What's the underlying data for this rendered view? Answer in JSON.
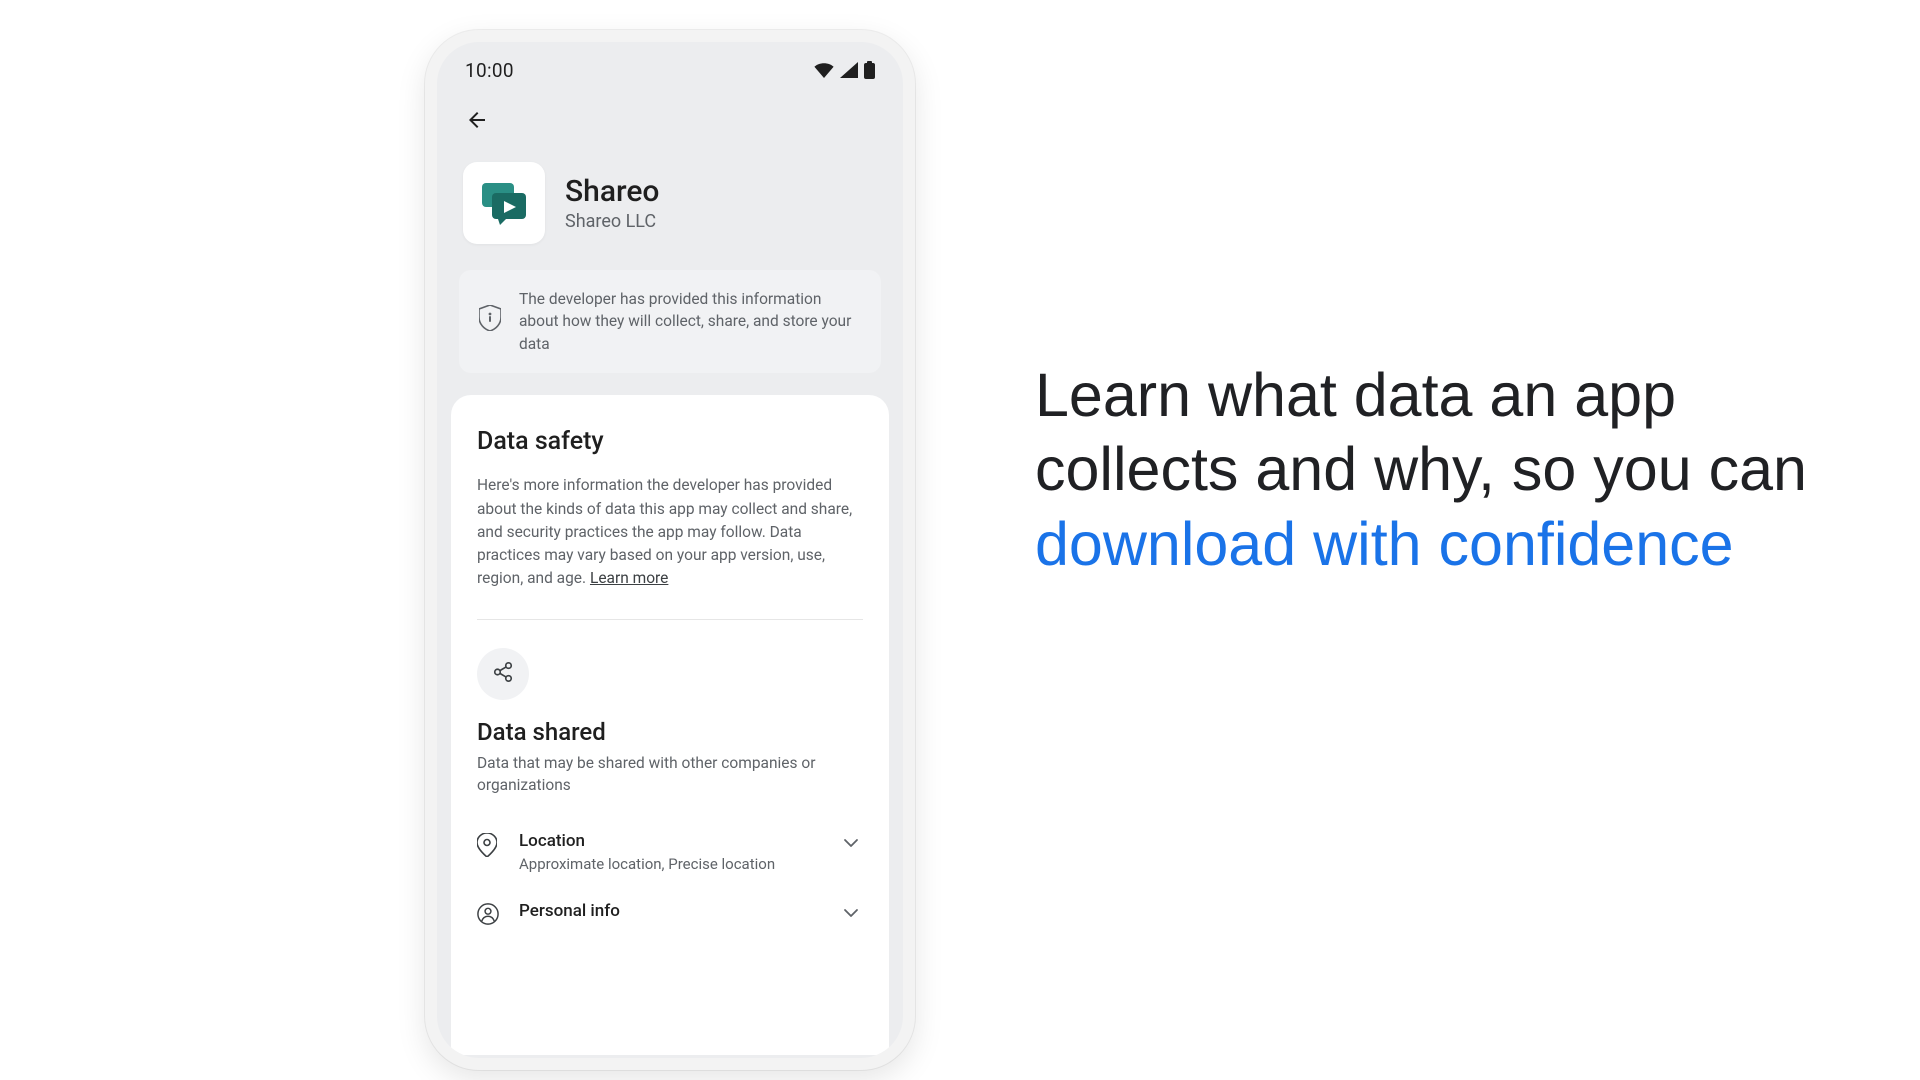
{
  "statusbar": {
    "time": "10:00"
  },
  "app": {
    "name": "Shareo",
    "developer": "Shareo LLC"
  },
  "banner": {
    "text": "The developer has provided this information about how they will collect, share, and store your data"
  },
  "safety": {
    "title": "Data safety",
    "description": "Here's more information the developer has provided about the kinds of data this app may collect and share, and security practices the app may follow. Data practices may vary based on your app version, use, region, and age. ",
    "learn_more": "Learn more "
  },
  "shared": {
    "title": "Data shared",
    "subtitle": "Data that may be shared with other companies or organizations",
    "items": [
      {
        "title": "Location",
        "subtitle": "Approximate location, Precise location"
      },
      {
        "title": "Personal info",
        "subtitle": ""
      }
    ]
  },
  "headline": {
    "line1": "Learn what data an app",
    "line2": "collects and why, so you can",
    "accent": "download with confidence"
  }
}
